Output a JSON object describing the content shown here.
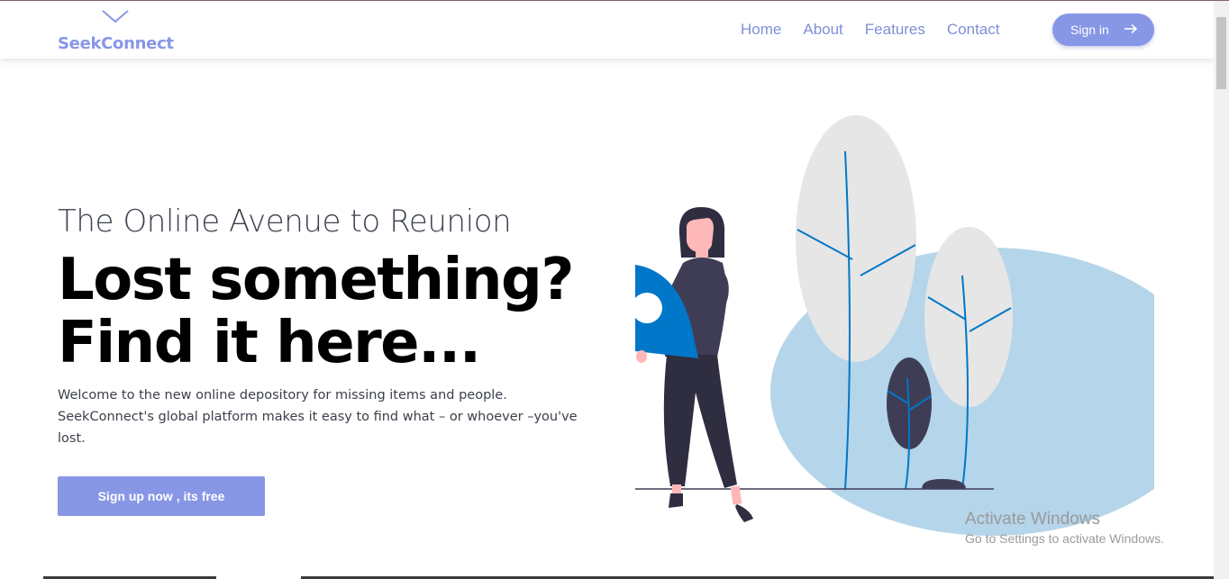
{
  "brand": {
    "name": "SeekConnect",
    "color": "#8797e6",
    "icon": "chevron-down-icon"
  },
  "nav": {
    "links": [
      {
        "label": "Home"
      },
      {
        "label": "About"
      },
      {
        "label": "Features"
      },
      {
        "label": "Contact"
      }
    ],
    "signin_label": "Sign in",
    "signin_icon": "arrow-right-icon"
  },
  "hero": {
    "subtitle": "The Online Avenue to Reunion",
    "headline_line1": "Lost something?",
    "headline_line2": "Find it here...",
    "description": "Welcome to the new online depository for missing items and people. SeekConnect's global platform makes it easy to find what – or whoever –you've lost.",
    "cta_label": "Sign up now , its free"
  },
  "illustration": {
    "name": "woman-holding-location-pin-with-trees",
    "accent": "#0077c8",
    "blob": "#b5d5ea",
    "tree": "#e6e6e6"
  },
  "watermark": {
    "title": "Activate Windows",
    "subtitle": "Go to Settings to activate Windows."
  }
}
